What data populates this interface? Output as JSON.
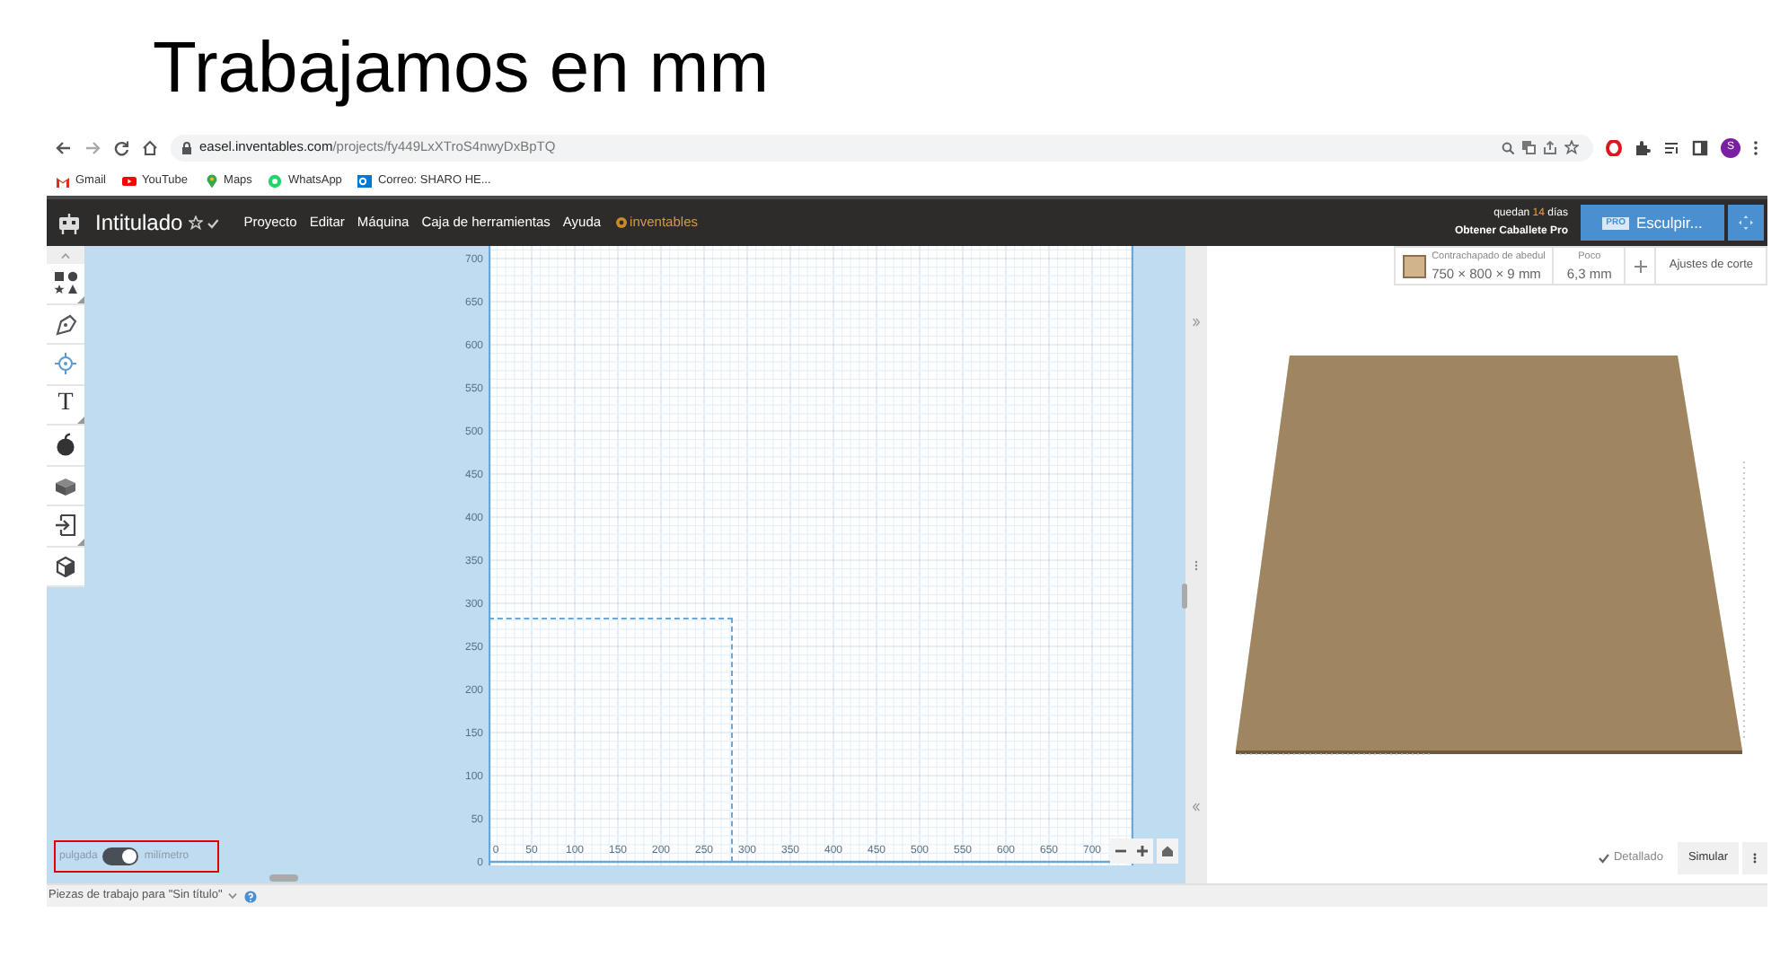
{
  "slide_title": "Trabajamos en mm",
  "browser": {
    "url_host": "easel.inventables.com",
    "url_path": "/projects/fy449LxXTroS4nwyDxBpTQ",
    "profile_initial": "S",
    "bookmarks": [
      {
        "kind": "gmail",
        "label": "Gmail"
      },
      {
        "kind": "youtube",
        "label": "YouTube"
      },
      {
        "kind": "maps",
        "label": "Maps"
      },
      {
        "kind": "whatsapp",
        "label": "WhatsApp"
      },
      {
        "kind": "outlook",
        "label": "Correo: SHARO HE..."
      }
    ]
  },
  "app_header": {
    "title": "Intitulado",
    "menu": [
      "Proyecto",
      "Editar",
      "Máquina",
      "Caja de herramientas",
      "Ayuda"
    ],
    "brand": "inventables",
    "trial": {
      "prefix": "quedan",
      "days": "14",
      "suffix": "días",
      "link": "Obtener Caballete Pro"
    },
    "carve_button": {
      "badge": "PRO",
      "label": "Esculpir..."
    }
  },
  "toolbar": [
    {
      "kind": "shapes",
      "has_submenu": true
    },
    {
      "kind": "pen",
      "has_submenu": false
    },
    {
      "kind": "point",
      "has_submenu": false
    },
    {
      "kind": "text",
      "glyph": "T",
      "has_submenu": true
    },
    {
      "kind": "apple",
      "has_submenu": false
    },
    {
      "kind": "box",
      "has_submenu": false
    },
    {
      "kind": "import",
      "has_submenu": true
    },
    {
      "kind": "cube",
      "has_submenu": false
    }
  ],
  "canvas": {
    "y_labels": [
      "700",
      "650",
      "600",
      "550",
      "500",
      "450",
      "400",
      "350",
      "300",
      "250",
      "200",
      "150",
      "100",
      "50",
      "0"
    ],
    "x_labels": [
      "0",
      "50",
      "100",
      "150",
      "200",
      "250",
      "300",
      "350",
      "400",
      "450",
      "500",
      "550",
      "600",
      "650",
      "700"
    ],
    "unit_toggle": {
      "left": "pulgada",
      "right": "milímetro",
      "on": true
    }
  },
  "material": {
    "name": "Contrachapado de abedul",
    "size": "750 × 800 × 9 mm",
    "bit_label": "Poco",
    "bit_value": "6,3 mm",
    "cut_settings": "Ajustes de corte"
  },
  "preview": {
    "detail_label": "Detallado",
    "detailed": true,
    "simulate": "Simular"
  },
  "workpieces": {
    "label": "Piezas de trabajo para \"Sin título\""
  }
}
